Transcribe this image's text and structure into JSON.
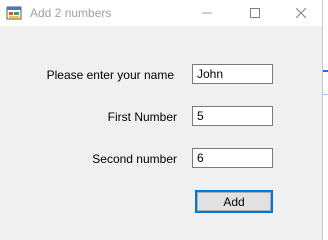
{
  "window": {
    "title": "Add 2 numbers",
    "icon": "form-icon"
  },
  "controls": {
    "minimize_icon": "minimize-icon",
    "maximize_icon": "maximize-icon",
    "close_icon": "close-icon"
  },
  "form": {
    "name_label": "Please enter your name",
    "name_value": "John",
    "first_label": "First Number",
    "first_value": "5",
    "second_label": "Second number",
    "second_value": "6",
    "add_button": "Add"
  },
  "colors": {
    "form_background": "#f0f0f0",
    "button_focus_border": "#0078d7",
    "title_text": "#a0a0a0"
  }
}
